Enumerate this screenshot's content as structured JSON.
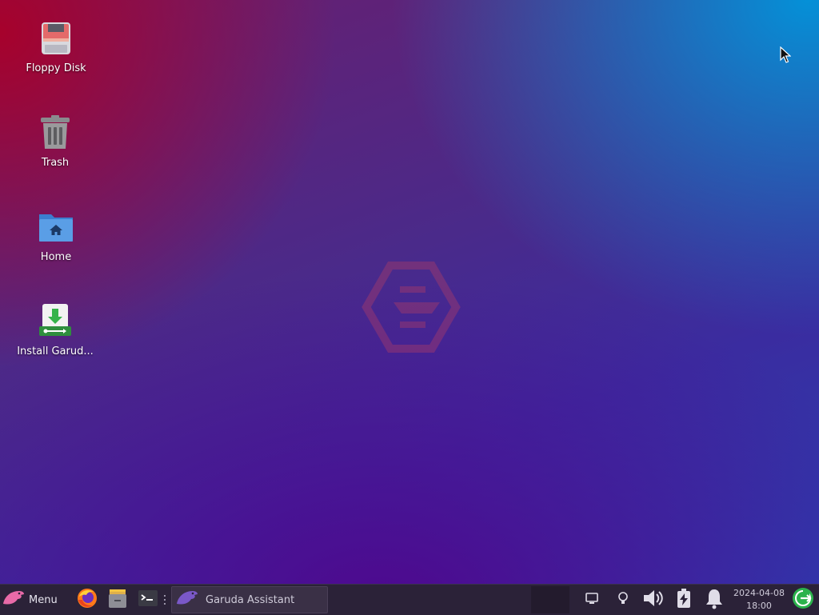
{
  "desktop": {
    "icons": [
      {
        "label": "Floppy Disk",
        "icon": "floppy-disk-icon"
      },
      {
        "label": "Trash",
        "icon": "trash-icon"
      },
      {
        "label": "Home",
        "icon": "home-folder-icon"
      },
      {
        "label": "Install Garud...",
        "icon": "install-garuda-icon"
      }
    ]
  },
  "taskbar": {
    "menu_label": "Menu",
    "launchers": [
      {
        "name": "firefox",
        "icon": "firefox-icon"
      },
      {
        "name": "file-manager",
        "icon": "file-manager-icon"
      },
      {
        "name": "terminal",
        "icon": "terminal-icon"
      }
    ],
    "tasks": [
      {
        "label": "Garuda Assistant",
        "icon": "garuda-eagle-icon"
      }
    ],
    "tray": [
      {
        "name": "display",
        "icon": "display-icon"
      },
      {
        "name": "redshift",
        "icon": "lightbulb-icon"
      },
      {
        "name": "volume",
        "icon": "volume-icon"
      },
      {
        "name": "power",
        "icon": "battery-charging-icon"
      },
      {
        "name": "notifications",
        "icon": "bell-icon"
      }
    ],
    "clock": {
      "date": "2024-04-08",
      "time": "18:00"
    },
    "logout_icon": "logout-icon"
  },
  "colors": {
    "taskbar_bg": "#2b2238",
    "accent_green": "#2bb24c"
  }
}
